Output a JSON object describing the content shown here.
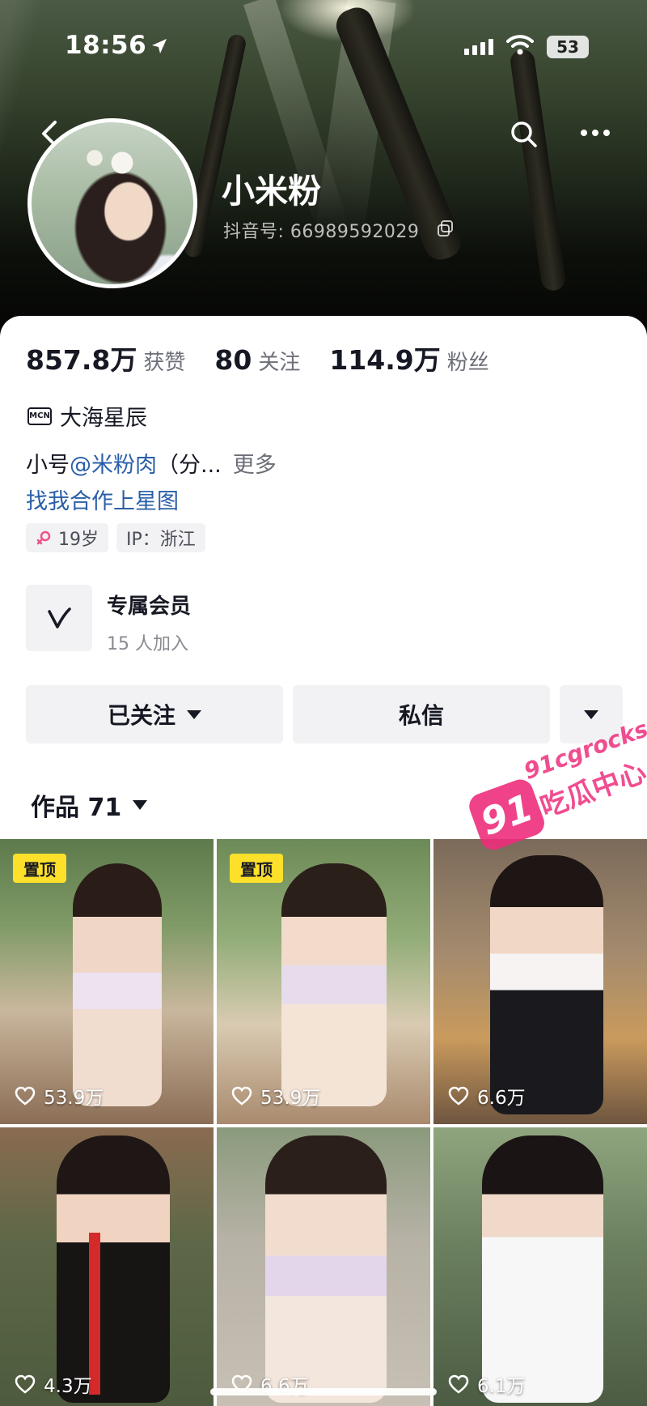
{
  "status_bar": {
    "time": "18:56",
    "battery": "53"
  },
  "profile": {
    "name": "小米粉",
    "douyin_id": "抖音号: 66989592029"
  },
  "stats": [
    {
      "value": "857.8万",
      "label": "获赞"
    },
    {
      "value": "80",
      "label": "关注"
    },
    {
      "value": "114.9万",
      "label": "粉丝"
    }
  ],
  "mcn": {
    "badge": "MCN",
    "name": "大海星辰"
  },
  "bio": {
    "prefix": "小号",
    "mention": "@米粉肉",
    "suffix": "（分...",
    "more": "更多"
  },
  "coop_link": "找我合作上星图",
  "tags": {
    "age": "19岁",
    "ip": "IP：浙江"
  },
  "membership": {
    "title": "专属会员",
    "subtitle": "15 人加入"
  },
  "actions": {
    "follow": "已关注",
    "message": "私信"
  },
  "works_tab": {
    "label": "作品 71"
  },
  "watermark": {
    "badge": "91",
    "site": "91cgrocks",
    "name": "吃瓜中心"
  },
  "videos": [
    {
      "pinned": true,
      "pin_label": "置顶",
      "likes": "53.9万"
    },
    {
      "pinned": true,
      "pin_label": "置顶",
      "likes": "53.9万"
    },
    {
      "pinned": false,
      "likes": "6.6万"
    },
    {
      "pinned": false,
      "likes": "4.3万"
    },
    {
      "pinned": false,
      "likes": "6.6万"
    },
    {
      "pinned": false,
      "likes": "6.1万"
    }
  ],
  "colors": {
    "link": "#2a5fa8",
    "pin": "#fde02a",
    "watermark": "#ee2e7d",
    "button_bg": "#f2f2f4"
  }
}
